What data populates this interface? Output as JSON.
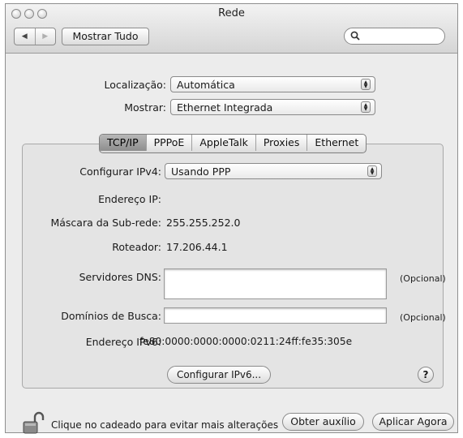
{
  "window": {
    "title": "Rede"
  },
  "toolbar": {
    "back_icon": "arrow-left-icon",
    "forward_icon": "arrow-right-icon",
    "show_all_label": "Mostrar Tudo",
    "search_placeholder": ""
  },
  "location": {
    "label": "Localização:",
    "value": "Automática"
  },
  "show": {
    "label": "Mostrar:",
    "value": "Ethernet Integrada"
  },
  "tabs": [
    {
      "label": "TCP/IP",
      "active": true
    },
    {
      "label": "PPPoE",
      "active": false
    },
    {
      "label": "AppleTalk",
      "active": false
    },
    {
      "label": "Proxies",
      "active": false
    },
    {
      "label": "Ethernet",
      "active": false
    }
  ],
  "tcpip": {
    "configure_ipv4_label": "Configurar IPv4:",
    "configure_ipv4_value": "Usando PPP",
    "ip_label": "Endereço IP:",
    "ip_value": "",
    "subnet_label": "Máscara da Sub-rede:",
    "subnet_value": "255.255.252.0",
    "router_label": "Roteador:",
    "router_value": "17.206.44.1",
    "dns_label": "Servidores DNS:",
    "dns_value": "",
    "dns_optional": "(Opcional)",
    "search_domains_label": "Domínios de Busca:",
    "search_domains_value": "",
    "search_domains_optional": "(Opcional)",
    "ipv6_label": "Endereço IPv6:",
    "ipv6_value": "fe80:0000:0000:0000:0211:24ff:fe35:305e",
    "configure_ipv6_button": "Configurar IPv6...",
    "help_label": "?"
  },
  "footer": {
    "lock_text": "Clique no cadeado para evitar mais alterações",
    "assist_button": "Obter auxílio",
    "apply_button": "Aplicar Agora"
  }
}
